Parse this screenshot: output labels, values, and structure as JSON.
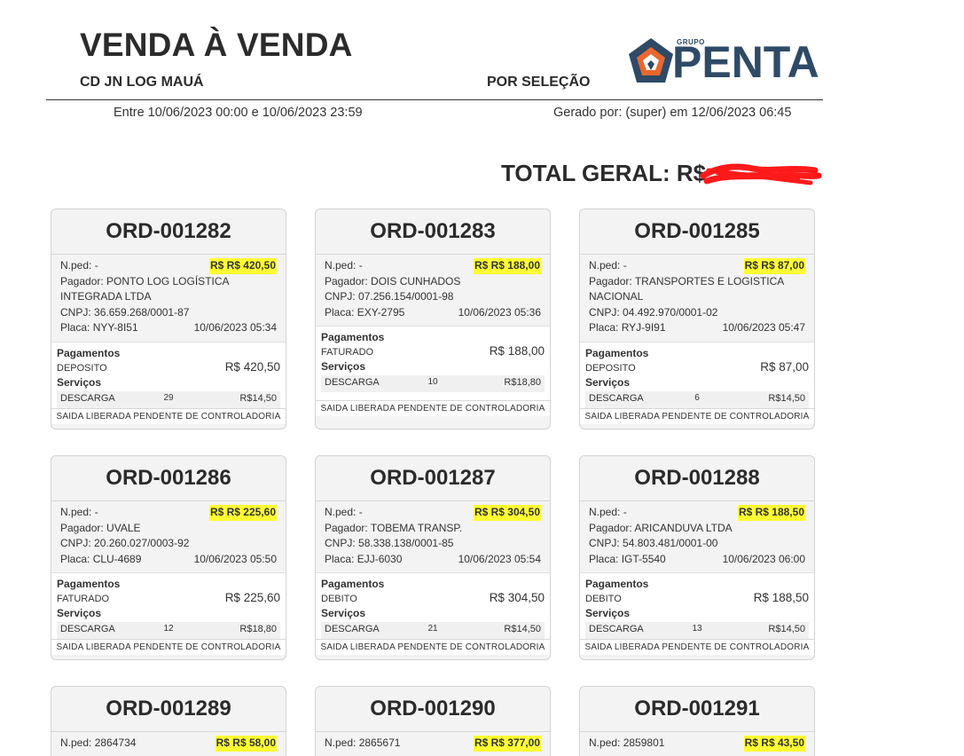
{
  "header": {
    "title": "VENDA À VENDA",
    "location": "CD JN LOG MAUÁ",
    "mode": "POR SELEÇÃO",
    "period": "Entre 10/06/2023 00:00 e 10/06/2023 23:59",
    "generated": "Gerado por: (super) em 12/06/2023 06:45",
    "total_label": "TOTAL GERAL: R$"
  },
  "logo": {
    "group_text": "GRUPO",
    "word": "PENTA",
    "colors": {
      "navy": "#2e4a66",
      "orange": "#e9682f"
    }
  },
  "labels": {
    "nped": "N.ped:",
    "pagador": "Pagador:",
    "cnpj": "CNPJ:",
    "placa": "Placa:",
    "pagamentos": "Pagamentos",
    "servicos": "Serviços"
  },
  "orders": [
    {
      "id": "ORD-001282",
      "nped": "-",
      "total": "R$ R$ 420,50",
      "pagador_l1": "PONTO LOG LOGÍSTICA",
      "pagador_l2": "INTEGRADA LTDA",
      "cnpj": "36.659.268/0001-87",
      "placa": "NYY-8I51",
      "datetime": "10/06/2023 05:34",
      "payment_method": "DEPOSITO",
      "payment_amount": "R$ 420,50",
      "service": "DESCARGA",
      "service_qty": "29",
      "service_value": "R$14,50",
      "footer": "SAIDA LIBERADA PENDENTE DE CONTROLADORIA"
    },
    {
      "id": "ORD-001283",
      "nped": "-",
      "total": "R$ R$ 188,00",
      "pagador_l1": "DOIS CUNHADOS",
      "pagador_l2": "",
      "cnpj": "07.256.154/0001-98",
      "placa": "EXY-2795",
      "datetime": "10/06/2023 05:36",
      "payment_method": "FATURADO",
      "payment_amount": "R$ 188,00",
      "service": "DESCARGA",
      "service_qty": "10",
      "service_value": "R$18,80",
      "footer": "SAIDA LIBERADA PENDENTE DE CONTROLADORIA"
    },
    {
      "id": "ORD-001285",
      "nped": "-",
      "total": "R$ R$ 87,00",
      "pagador_l1": "TRANSPORTES E LOGISTICA",
      "pagador_l2": "NACIONAL",
      "cnpj": "04.492.970/0001-02",
      "placa": "RYJ-9I91",
      "datetime": "10/06/2023 05:47",
      "payment_method": "DEPOSITO",
      "payment_amount": "R$ 87,00",
      "service": "DESCARGA",
      "service_qty": "6",
      "service_value": "R$14,50",
      "footer": "SAIDA LIBERADA PENDENTE DE CONTROLADORIA"
    },
    {
      "id": "ORD-001286",
      "nped": "-",
      "total": "R$ R$ 225,60",
      "pagador_l1": "UVALE",
      "pagador_l2": "",
      "cnpj": "20.260.027/0003-92",
      "placa": "CLU-4689",
      "datetime": "10/06/2023 05:50",
      "payment_method": "FATURADO",
      "payment_amount": "R$ 225,60",
      "service": "DESCARGA",
      "service_qty": "12",
      "service_value": "R$18,80",
      "footer": "SAIDA LIBERADA PENDENTE DE CONTROLADORIA"
    },
    {
      "id": "ORD-001287",
      "nped": "-",
      "total": "R$ R$ 304,50",
      "pagador_l1": "TOBEMA TRANSP.",
      "pagador_l2": "",
      "cnpj": "58.338.138/0001-85",
      "placa": "EJJ-6030",
      "datetime": "10/06/2023 05:54",
      "payment_method": "DEBITO",
      "payment_amount": "R$ 304,50",
      "service": "DESCARGA",
      "service_qty": "21",
      "service_value": "R$14,50",
      "footer": "SAIDA LIBERADA PENDENTE DE CONTROLADORIA"
    },
    {
      "id": "ORD-001288",
      "nped": "-",
      "total": "R$ R$ 188,50",
      "pagador_l1": "ARICANDUVA LTDA",
      "pagador_l2": "",
      "cnpj": "54.803.481/0001-00",
      "placa": "IGT-5540",
      "datetime": "10/06/2023 06:00",
      "payment_method": "DEBITO",
      "payment_amount": "R$ 188,50",
      "service": "DESCARGA",
      "service_qty": "13",
      "service_value": "R$14,50",
      "footer": "SAIDA LIBERADA PENDENTE DE CONTROLADORIA"
    },
    {
      "id": "ORD-001289",
      "nped": "2864734",
      "total": "R$ R$ 58,00"
    },
    {
      "id": "ORD-001290",
      "nped": "2865671",
      "total": "R$ R$ 377,00"
    },
    {
      "id": "ORD-001291",
      "nped": "2859801",
      "total": "R$ R$ 43,50"
    }
  ]
}
